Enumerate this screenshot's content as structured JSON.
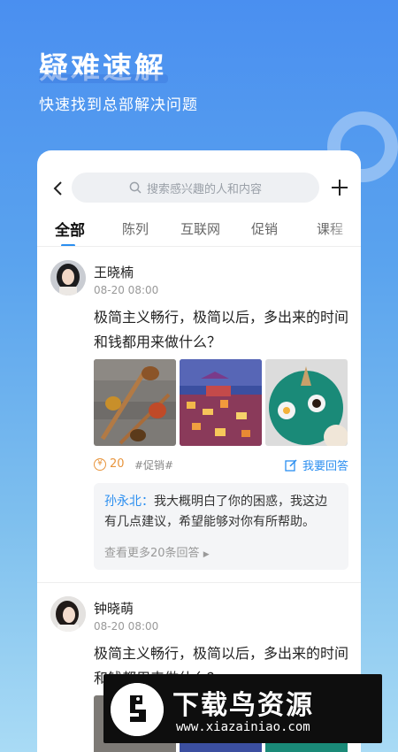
{
  "hero": {
    "title": "疑难速解",
    "subtitle": "快速找到总部解决问题"
  },
  "search": {
    "placeholder": "搜索感兴趣的人和内容"
  },
  "tabs": [
    "全部",
    "陈列",
    "互联网",
    "促销",
    "课程"
  ],
  "posts": [
    {
      "name": "王晓楠",
      "time": "08-20 08:00",
      "question": "极简主义畅行，极简以后，多出来的时间和钱都用来做什么？",
      "coins": "20",
      "tag": "#促销#",
      "answer_label": "我要回答",
      "reply_author": "孙永北：",
      "reply_text": "我大概明白了你的困惑，我这边有几点建议，希望能够对你有所帮助。",
      "more_label": "查看更多20条回答"
    },
    {
      "name": "钟晓萌",
      "time": "08-20 08:00",
      "question": "极简主义畅行，极简以后，多出来的时间和钱都用来做什么？"
    }
  ],
  "banner": {
    "title": "下载鸟资源",
    "url": "www.xiazainiao.com"
  },
  "colors": {
    "accent": "#2a8ef0",
    "coin": "#e8953d"
  }
}
